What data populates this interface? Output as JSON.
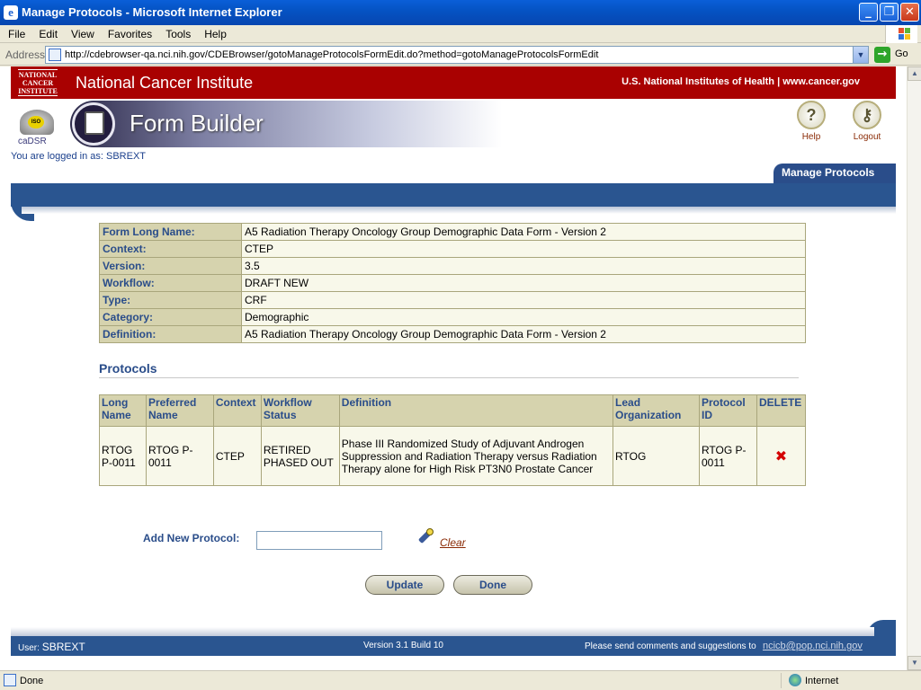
{
  "window": {
    "title": "Manage Protocols - Microsoft Internet Explorer",
    "min_glyph": "_",
    "max_glyph": "❐",
    "close_glyph": "✕"
  },
  "menu": [
    "File",
    "Edit",
    "View",
    "Favorites",
    "Tools",
    "Help"
  ],
  "address": {
    "label": "Address",
    "url": "http://cdebrowser-qa.nci.nih.gov/CDEBrowser/gotoManageProtocolsFormEdit.do?method=gotoManageProtocolsFormEdit",
    "go_label": "Go"
  },
  "nci": {
    "logo_lines": [
      "NATIONAL",
      "CANCER",
      "INSTITUTE"
    ],
    "name": "National Cancer Institute",
    "right_text": "U.S. National Institutes of Health  |  www.cancer.gov"
  },
  "header": {
    "cadsr_text": "caDSR",
    "iso_text": "ISO",
    "app_title": "Form Builder",
    "help_label": "Help",
    "logout_label": "Logout"
  },
  "session": {
    "logged_in_text": "You are logged in as: SBREXT"
  },
  "nav": {
    "active_tab": "Manage Protocols"
  },
  "form_details": [
    {
      "label": "Form Long Name:",
      "value": "A5 Radiation Therapy Oncology Group Demographic Data Form - Version 2"
    },
    {
      "label": "Context:",
      "value": "CTEP"
    },
    {
      "label": "Version:",
      "value": "3.5"
    },
    {
      "label": "Workflow:",
      "value": "DRAFT NEW"
    },
    {
      "label": "Type:",
      "value": "CRF"
    },
    {
      "label": "Category:",
      "value": "Demographic"
    },
    {
      "label": "Definition:",
      "value": "A5 Radiation Therapy Oncology Group Demographic Data Form - Version 2"
    }
  ],
  "protocols": {
    "heading": "Protocols",
    "columns": [
      "Long Name",
      "Preferred Name",
      "Context",
      "Workflow Status",
      "Definition",
      "Lead Organization",
      "Protocol ID",
      "DELETE"
    ],
    "rows": [
      {
        "long_name": "RTOG P-0011",
        "preferred_name": "RTOG P-0011",
        "context": "CTEP",
        "workflow_status": "RETIRED PHASED OUT",
        "definition": "Phase III Randomized Study of Adjuvant Androgen Suppression and Radiation Therapy versus Radiation Therapy alone for High Risk PT3N0 Prostate Cancer",
        "lead_org": "RTOG",
        "protocol_id": "RTOG P-0011",
        "delete_glyph": "✖"
      }
    ]
  },
  "add_protocol": {
    "label": "Add New Protocol:",
    "value": "",
    "clear_label": "Clear"
  },
  "buttons": {
    "update": "Update",
    "done": "Done"
  },
  "footer": {
    "user_label": "User:",
    "user_value": "SBREXT",
    "version": "Version 3.1  Build 10",
    "suggestion": "Please send comments and suggestions to",
    "email": "ncicb@pop.nci.nih.gov"
  },
  "status": {
    "text": "Done",
    "zone": "Internet"
  },
  "colors": {
    "nci_red": "#a90101",
    "nav_blue": "#2a5590",
    "label_bg": "#d6d3ae",
    "value_bg": "#f8f8ea",
    "delete_red": "#d40000"
  }
}
